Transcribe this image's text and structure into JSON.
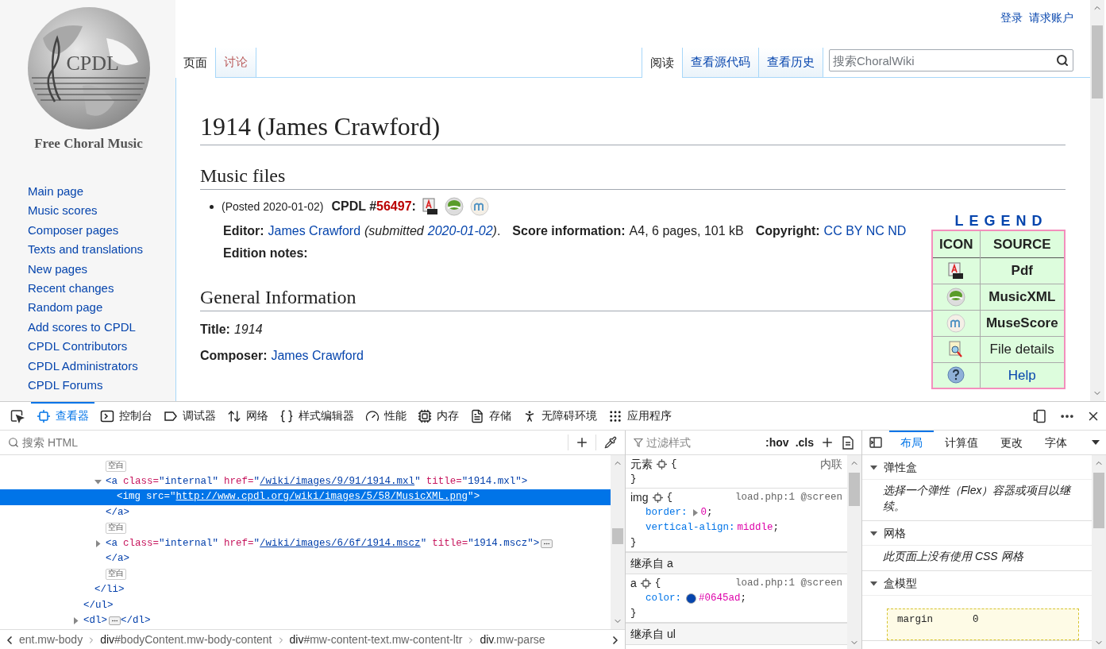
{
  "header": {
    "personal_links": [
      "登录",
      "请求账户"
    ]
  },
  "logo": {
    "name": "CPDL",
    "tagline": "Free Choral Music"
  },
  "sidebar": {
    "items": [
      "Main page",
      "Music scores",
      "Composer pages",
      "Texts and translations",
      "New pages",
      "Recent changes",
      "Random page",
      "Add scores to CPDL",
      "CPDL Contributors",
      "CPDL Administrators",
      "CPDL Forums"
    ]
  },
  "page_tabs": [
    {
      "label": "页面",
      "selected": true,
      "kind": "link"
    },
    {
      "label": "讨论",
      "selected": false,
      "kind": "new"
    }
  ],
  "view_tabs": [
    {
      "label": "阅读",
      "selected": true
    },
    {
      "label": "查看源代码",
      "selected": false
    },
    {
      "label": "查看历史",
      "selected": false
    }
  ],
  "search": {
    "placeholder": "搜索ChoralWiki"
  },
  "article": {
    "title": "1914 (James Crawford)",
    "music_files": {
      "heading": "Music files",
      "posted": "(Posted 2020-01-02)",
      "cpdl_label": "CPDL #",
      "cpdl_number": "56497",
      "cpdl_suffix": ":",
      "file_icons": [
        {
          "kind": "pdf"
        },
        {
          "kind": "musicxml"
        },
        {
          "kind": "musescore"
        }
      ],
      "details": [
        {
          "kind": "label",
          "text": "Editor:"
        },
        {
          "kind": "link",
          "text": "James Crawford"
        },
        {
          "kind": "italic",
          "text": "(submitted"
        },
        {
          "kind": "italic-link",
          "text": "2020-01-02"
        },
        {
          "kind": "italic",
          "text": ")"
        },
        {
          "kind": "text",
          "text": "."
        },
        {
          "kind": "label",
          "text": "Score information:"
        },
        {
          "kind": "text",
          "text": "A4, 6 pages, 101 kB"
        },
        {
          "kind": "label",
          "text": "Copyright:"
        },
        {
          "kind": "link",
          "text": "CC BY NC ND"
        }
      ],
      "edition_notes": "Edition notes:"
    },
    "general": {
      "heading": "General Information",
      "fields": [
        {
          "label": "Title:",
          "value": "1914",
          "kind": "italic"
        },
        {
          "label": "Composer:",
          "value": "James Crawford",
          "kind": "link"
        }
      ]
    }
  },
  "legend": {
    "title": "LEGEND",
    "columns": [
      "ICON",
      "SOURCE"
    ],
    "rows": [
      {
        "kind": "pdf",
        "label": "Pdf",
        "bold": true,
        "link": false
      },
      {
        "kind": "musicxml",
        "label": "MusicXML",
        "bold": true,
        "link": false
      },
      {
        "kind": "musescore",
        "label": "MuseScore",
        "bold": true,
        "link": false
      },
      {
        "kind": "details",
        "label": "File details",
        "bold": false,
        "link": false
      },
      {
        "kind": "help",
        "label": "Help",
        "bold": false,
        "link": true
      }
    ]
  },
  "devtools": {
    "tools": [
      {
        "label": "查看器",
        "kind": "inspector",
        "selected": true
      },
      {
        "label": "控制台",
        "kind": "console",
        "selected": false
      },
      {
        "label": "调试器",
        "kind": "debugger",
        "selected": false
      },
      {
        "label": "网络",
        "kind": "network",
        "selected": false
      },
      {
        "label": "样式编辑器",
        "kind": "style",
        "selected": false
      },
      {
        "label": "性能",
        "kind": "performance",
        "selected": false
      },
      {
        "label": "内存",
        "kind": "memory",
        "selected": false
      },
      {
        "label": "存储",
        "kind": "storage",
        "selected": false
      },
      {
        "label": "无障碍环境",
        "kind": "accessibility",
        "selected": false
      },
      {
        "label": "应用程序",
        "kind": "application",
        "selected": false
      }
    ],
    "html_search": {
      "placeholder": "搜索 HTML"
    },
    "markup": {
      "nodes": [
        {
          "kind": "partial",
          "children": [
            {
              "kind": "partial",
              "children": [
                {
                  "kind": "whitespace",
                  "label": "空白"
                },
                {
                  "kind": "element",
                  "expanded": true,
                  "selected": false,
                  "tokens": [
                    {
                      "kind": "tag",
                      "text": "<a"
                    },
                    {
                      "kind": "attr",
                      "text": "class="
                    },
                    {
                      "kind": "value",
                      "text": "\"internal\""
                    },
                    {
                      "kind": "attr",
                      "text": "href="
                    },
                    {
                      "kind": "value",
                      "text": "\""
                    },
                    {
                      "kind": "link",
                      "text": "/wiki/images/9/91/1914.mxl"
                    },
                    {
                      "kind": "value",
                      "text": "\""
                    },
                    {
                      "kind": "attr",
                      "text": "title="
                    },
                    {
                      "kind": "value",
                      "text": "\"1914.mxl\""
                    },
                    {
                      "kind": "tag",
                      "text": ">"
                    }
                  ],
                  "children": [
                    {
                      "kind": "element",
                      "selected": true,
                      "tokens": [
                        {
                          "kind": "tag",
                          "text": "<img"
                        },
                        {
                          "kind": "attr",
                          "text": "src="
                        },
                        {
                          "kind": "value",
                          "text": "\""
                        },
                        {
                          "kind": "link",
                          "text": "http://www.cpdl.org/wiki/images/5/58/MusicXML.png"
                        },
                        {
                          "kind": "value",
                          "text": "\""
                        },
                        {
                          "kind": "tag",
                          "text": ">"
                        }
                      ]
                    }
                  ],
                  "close": {
                    "inline": false,
                    "text": "</a>"
                  }
                },
                {
                  "kind": "whitespace",
                  "label": "空白"
                },
                {
                  "kind": "element",
                  "expanded": false,
                  "selected": false,
                  "tokens": [
                    {
                      "kind": "tag",
                      "text": "<a"
                    },
                    {
                      "kind": "attr",
                      "text": "class="
                    },
                    {
                      "kind": "value",
                      "text": "\"internal\""
                    },
                    {
                      "kind": "attr",
                      "text": "href="
                    },
                    {
                      "kind": "value",
                      "text": "\""
                    },
                    {
                      "kind": "link",
                      "text": "/wiki/images/6/6f/1914.mscz"
                    },
                    {
                      "kind": "value",
                      "text": "\""
                    },
                    {
                      "kind": "attr",
                      "text": "title="
                    },
                    {
                      "kind": "value",
                      "text": "\"1914.mscz\""
                    },
                    {
                      "kind": "tag",
                      "text": ">"
                    }
                  ],
                  "close": {
                    "inline": false,
                    "text": "</a>"
                  }
                },
                {
                  "kind": "whitespace",
                  "label": "空白"
                }
              ],
              "close_tag": "</li>"
            }
          ],
          "close_tag": "</ul>"
        },
        {
          "kind": "element",
          "expanded": false,
          "selected": false,
          "tokens": [
            {
              "kind": "tag",
              "text": "<dl>"
            }
          ],
          "close": {
            "inline": true,
            "text": "</dl>"
          }
        }
      ]
    },
    "breadcrumbs": [
      {
        "rest": "ent.mw-body"
      },
      {
        "tag": "div",
        "rest": "#bodyContent.mw-body-content"
      },
      {
        "tag": "div",
        "rest": "#mw-content-text.mw-content-ltr"
      },
      {
        "tag": "div",
        "rest": ".mw-parse"
      }
    ],
    "rules_filter": {
      "placeholder": "过滤样式",
      "hov": ":hov",
      "cls": ".cls"
    },
    "rules": [
      {
        "kind": "rule",
        "selector": "元素",
        "source": "内联",
        "open": "{",
        "close": "}"
      },
      {
        "kind": "rule",
        "selector": "img",
        "source": "load.php:1 @screen",
        "open": "{",
        "close": "}",
        "declarations": [
          {
            "kind": "expandable",
            "property": "border:",
            "value": "0",
            "end": ";"
          },
          {
            "kind": "plain",
            "property": "vertical-align:",
            "value": "middle",
            "end": ";"
          }
        ]
      },
      {
        "kind": "inherited",
        "label": "继承自 a"
      },
      {
        "kind": "rule",
        "selector": "a",
        "source": "load.php:1 @screen",
        "open": "{",
        "close": "}",
        "declarations": [
          {
            "kind": "color",
            "property": "color:",
            "value": "#0645ad",
            "end": ";"
          }
        ]
      },
      {
        "kind": "inherited",
        "label": "继承自 ul"
      }
    ],
    "layout_tabs": [
      {
        "label": "布局",
        "selected": true
      },
      {
        "label": "计算值",
        "selected": false
      },
      {
        "label": "更改",
        "selected": false
      },
      {
        "label": "字体",
        "selected": false
      }
    ],
    "layout_sections": [
      {
        "kind": "note",
        "title": "弹性盒",
        "expanded": true,
        "note": "选择一个弹性（Flex）容器或项目以继续。"
      },
      {
        "kind": "note",
        "title": "网格",
        "expanded": true,
        "note": "此页面上没有使用 CSS 网格"
      },
      {
        "kind": "box",
        "title": "盒模型",
        "expanded": true,
        "box_label": "margin",
        "box_value": "0"
      }
    ]
  }
}
